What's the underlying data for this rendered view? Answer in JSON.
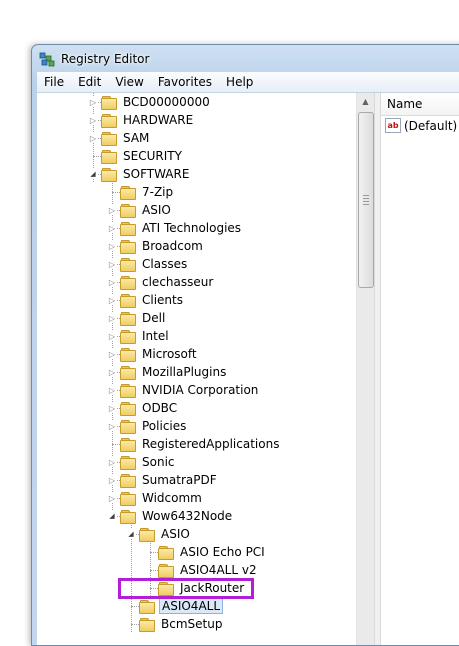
{
  "window": {
    "title": "Registry Editor"
  },
  "menu": [
    "File",
    "Edit",
    "View",
    "Favorites",
    "Help"
  ],
  "list": {
    "column_name": "Name",
    "values": [
      {
        "name": "(Default)",
        "icon": "string-value-icon"
      }
    ]
  },
  "tree": [
    {
      "label": "BCD00000000",
      "expander": "collapsed"
    },
    {
      "label": "HARDWARE",
      "expander": "collapsed"
    },
    {
      "label": "SAM",
      "expander": "collapsed"
    },
    {
      "label": "SECURITY",
      "expander": "none"
    },
    {
      "label": "SOFTWARE",
      "expander": "expanded"
    },
    {
      "label": "7-Zip",
      "expander": "none"
    },
    {
      "label": "ASIO",
      "expander": "collapsed"
    },
    {
      "label": "ATI Technologies",
      "expander": "collapsed"
    },
    {
      "label": "Broadcom",
      "expander": "collapsed"
    },
    {
      "label": "Classes",
      "expander": "collapsed"
    },
    {
      "label": "clechasseur",
      "expander": "collapsed"
    },
    {
      "label": "Clients",
      "expander": "collapsed"
    },
    {
      "label": "Dell",
      "expander": "collapsed"
    },
    {
      "label": "Intel",
      "expander": "collapsed"
    },
    {
      "label": "Microsoft",
      "expander": "collapsed"
    },
    {
      "label": "MozillaPlugins",
      "expander": "collapsed"
    },
    {
      "label": "NVIDIA Corporation",
      "expander": "collapsed"
    },
    {
      "label": "ODBC",
      "expander": "collapsed"
    },
    {
      "label": "Policies",
      "expander": "collapsed"
    },
    {
      "label": "RegisteredApplications",
      "expander": "none"
    },
    {
      "label": "Sonic",
      "expander": "collapsed"
    },
    {
      "label": "SumatraPDF",
      "expander": "collapsed"
    },
    {
      "label": "Widcomm",
      "expander": "collapsed"
    },
    {
      "label": "Wow6432Node",
      "expander": "expanded"
    },
    {
      "label": "ASIO",
      "expander": "expanded"
    },
    {
      "label": "ASIO Echo PCI",
      "expander": "none"
    },
    {
      "label": "ASIO4ALL v2",
      "expander": "none"
    },
    {
      "label": "JackRouter",
      "expander": "none"
    },
    {
      "label": "ASIO4ALL",
      "expander": "none"
    },
    {
      "label": "BcmSetup",
      "expander": "none"
    }
  ],
  "colors": {
    "highlight_border": "#b31fd6",
    "selection_bg": "#dbe8f7"
  }
}
